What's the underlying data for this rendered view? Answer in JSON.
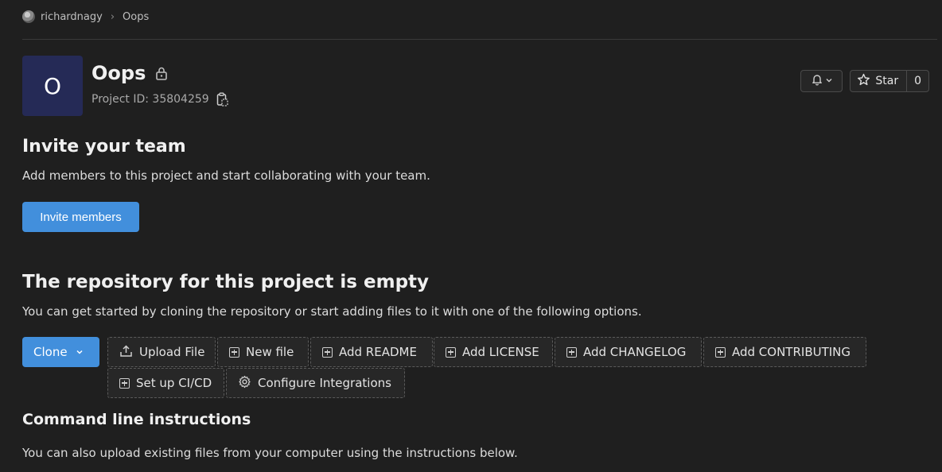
{
  "breadcrumb": {
    "items": [
      "richardnagy",
      "Oops"
    ],
    "separator": "›"
  },
  "project": {
    "avatar_letter": "O",
    "name": "Oops",
    "id_label": "Project ID: 35804259",
    "avatar_color": "#252a56"
  },
  "header_actions": {
    "star_label": "Star",
    "star_count": "0"
  },
  "invite": {
    "title": "Invite your team",
    "text": "Add members to this project and start collaborating with your team.",
    "button_label": "Invite members"
  },
  "repository": {
    "title": "The repository for this project is empty",
    "text": "You can get started by cloning the repository or start adding files to it with one of the following options.",
    "clone_label": "Clone",
    "actions": [
      {
        "label": "Upload File",
        "icon": "upload-icon"
      },
      {
        "label": "New file",
        "icon": "plus-square-icon"
      },
      {
        "label": "Add README",
        "icon": "plus-square-icon"
      },
      {
        "label": "Add LICENSE",
        "icon": "plus-square-icon"
      },
      {
        "label": "Add CHANGELOG",
        "icon": "plus-square-icon"
      },
      {
        "label": "Add CONTRIBUTING",
        "icon": "plus-square-icon"
      },
      {
        "label": "Set up CI/CD",
        "icon": "plus-square-icon"
      },
      {
        "label": "Configure Integrations",
        "icon": "settings-icon"
      }
    ]
  },
  "command_line": {
    "title": "Command line instructions",
    "text": "You can also upload existing files from your computer using the instructions below."
  },
  "colors": {
    "background": "#1f1f1f",
    "primary": "#428fdc",
    "border": "#4a4a4a"
  }
}
